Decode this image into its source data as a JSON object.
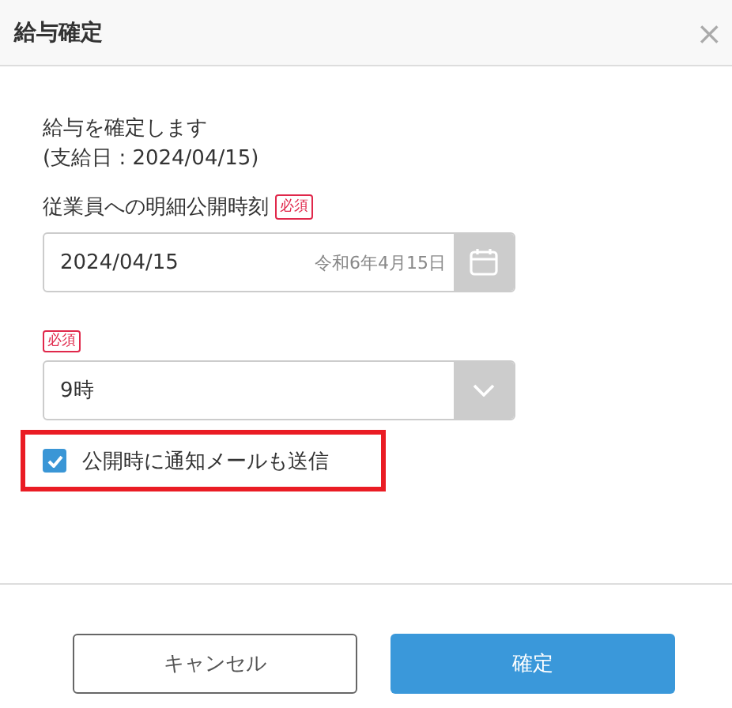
{
  "dialog": {
    "title": "給与確定",
    "close": "×"
  },
  "message": [
    "給与を確定します",
    "(支給日 : 2024/04/15)"
  ],
  "date_field": {
    "label": "従業員への明細公開時刻",
    "required": "必須",
    "value": "2024/04/15",
    "era_date": "令和6年4月15日"
  },
  "hour_field": {
    "required": "必須",
    "value": "9時"
  },
  "notify_checkbox": {
    "label": "公開時に通知メールも送信",
    "checked": true,
    "highlighted": true
  },
  "buttons": [
    {
      "label": "キャンセル",
      "kind": "secondary"
    },
    {
      "label": "確定",
      "kind": "primary"
    }
  ]
}
